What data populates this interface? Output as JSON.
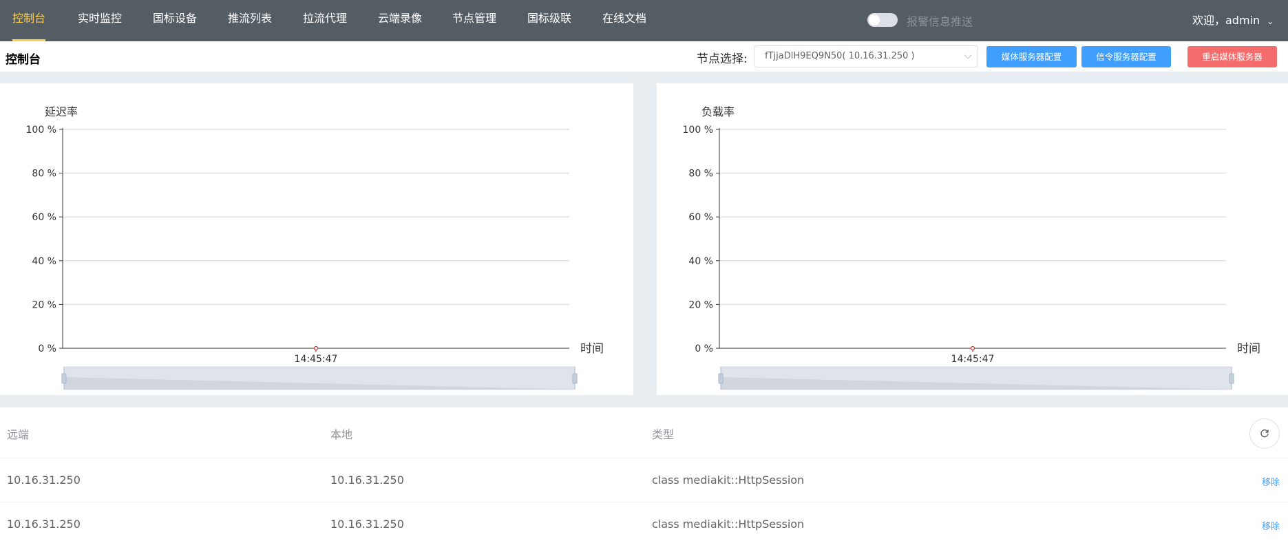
{
  "nav": {
    "items": [
      {
        "label": "控制台",
        "active": true
      },
      {
        "label": "实时监控"
      },
      {
        "label": "国标设备"
      },
      {
        "label": "推流列表"
      },
      {
        "label": "拉流代理"
      },
      {
        "label": "云端录像"
      },
      {
        "label": "节点管理"
      },
      {
        "label": "国标级联"
      },
      {
        "label": "在线文档"
      }
    ],
    "alarm_switch_label": "报警信息推送",
    "alarm_switch_on": false,
    "user_greeting": "欢迎，admin",
    "accent_color": "#ffd04b",
    "bg_color": "#545c64"
  },
  "header": {
    "title": "控制台",
    "node_label": "节点选择:",
    "node_value": "fTjjaDlH9EQ9N50( 10.16.31.250 )",
    "btn_media_config": "媒体服务器配置",
    "btn_signal_config": "信令服务器配置",
    "btn_restart": "重启媒体服务器"
  },
  "chart_data": [
    {
      "type": "line",
      "title": "延迟率",
      "xlabel": "时间",
      "ylabel": "",
      "ylim": [
        0,
        100
      ],
      "yticks": [
        "0 %",
        "20 %",
        "40 %",
        "60 %",
        "80 %",
        "100 %"
      ],
      "x": [
        "14:45:47"
      ],
      "series": [
        {
          "values": [
            0
          ],
          "color": "#c23531"
        }
      ],
      "grid": true,
      "dataZoom": true
    },
    {
      "type": "line",
      "title": "负载率",
      "xlabel": "时间",
      "ylabel": "",
      "ylim": [
        0,
        100
      ],
      "yticks": [
        "0 %",
        "20 %",
        "40 %",
        "60 %",
        "80 %",
        "100 %"
      ],
      "x": [
        "14:45:47"
      ],
      "series": [
        {
          "values": [
            0
          ],
          "color": "#c23531"
        }
      ],
      "grid": true,
      "dataZoom": true
    }
  ],
  "table": {
    "columns": [
      "远端",
      "本地",
      "类型"
    ],
    "rows": [
      {
        "remote": "10.16.31.250",
        "local": "10.16.31.250",
        "type": "class mediakit::HttpSession",
        "action": "移除"
      },
      {
        "remote": "10.16.31.250",
        "local": "10.16.31.250",
        "type": "class mediakit::HttpSession",
        "action": "移除"
      }
    ],
    "refresh_icon": "refresh-icon"
  }
}
